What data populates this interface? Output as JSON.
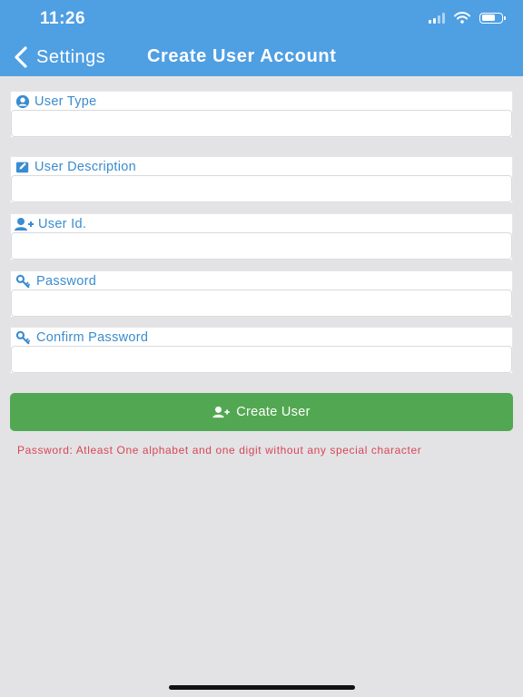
{
  "status_bar": {
    "time": "11:26"
  },
  "nav": {
    "back_label": "Settings",
    "title": "Create User Account"
  },
  "form": {
    "fields": [
      {
        "label": "User Type",
        "icon": "user-circle-icon",
        "value": ""
      },
      {
        "label": "User Description",
        "icon": "pencil-square-icon",
        "value": ""
      },
      {
        "label": "User Id.",
        "icon": "user-plus-icon",
        "value": ""
      },
      {
        "label": "Password",
        "icon": "key-icon",
        "value": ""
      },
      {
        "label": "Confirm Password",
        "icon": "key-icon",
        "value": ""
      }
    ],
    "submit_label": "Create User",
    "submit_icon": "user-plus-icon",
    "hint": "Password: Atleast One alphabet and one digit without any special character"
  },
  "colors": {
    "header": "#4f9fe3",
    "label": "#3a8cd0",
    "button": "#52a852",
    "hint": "#d84557",
    "background": "#e3e3e5"
  }
}
